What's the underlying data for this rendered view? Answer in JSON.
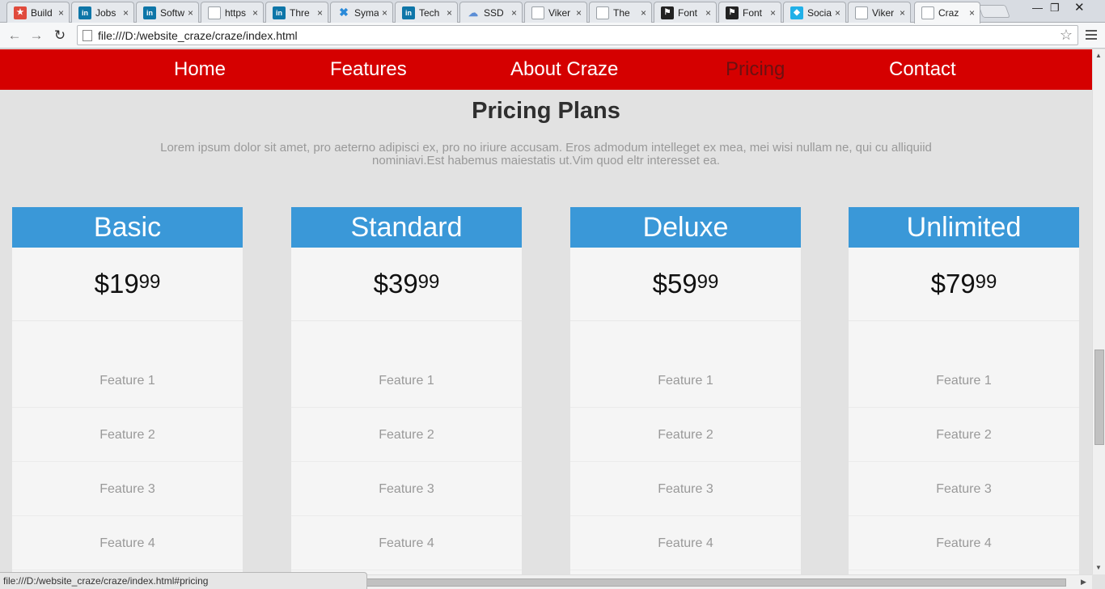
{
  "browser": {
    "tabs": [
      {
        "title": "Build",
        "favicon": "build-icon",
        "active": false
      },
      {
        "title": "Jobs",
        "favicon": "linkedin-icon",
        "active": false
      },
      {
        "title": "Softw",
        "favicon": "linkedin-icon",
        "active": false
      },
      {
        "title": "https",
        "favicon": "page-icon",
        "active": false
      },
      {
        "title": "Thre",
        "favicon": "linkedin-icon",
        "active": false
      },
      {
        "title": "Syma",
        "favicon": "x-icon",
        "active": false
      },
      {
        "title": "Tech",
        "favicon": "linkedin-icon",
        "active": false
      },
      {
        "title": "SSD",
        "favicon": "cloud-icon",
        "active": false
      },
      {
        "title": "Viker",
        "favicon": "page-icon",
        "active": false
      },
      {
        "title": "The",
        "favicon": "page-icon",
        "active": false
      },
      {
        "title": "Font",
        "favicon": "flag-icon",
        "active": false
      },
      {
        "title": "Font",
        "favicon": "flag-icon",
        "active": false
      },
      {
        "title": "Socia",
        "favicon": "social-icon",
        "active": false
      },
      {
        "title": "Viker",
        "favicon": "page-icon",
        "active": false
      },
      {
        "title": "Craz",
        "favicon": "page-icon",
        "active": true
      }
    ],
    "tab_close_glyph": "×",
    "url": "file:///D:/website_craze/craze/index.html",
    "status_url": "file:///D:/website_craze/craze/index.html#pricing"
  },
  "nav": {
    "items": [
      {
        "label": "Home",
        "current": false
      },
      {
        "label": "Features",
        "current": false
      },
      {
        "label": "About Craze",
        "current": false
      },
      {
        "label": "Pricing",
        "current": true
      },
      {
        "label": "Contact",
        "current": false
      }
    ]
  },
  "pricing": {
    "title": "Pricing Plans",
    "description": "Lorem ipsum dolor sit amet, pro aeterno adipisci ex, pro no iriure accusam. Eros admodum intelleget ex mea, mei wisi nullam ne, qui cu alliquiid nominiavi.Est habemus maiestatis ut.Vim quod eltr interesset ea.",
    "plans": [
      {
        "name": "Basic",
        "price_main": "$19",
        "price_cents": "99",
        "features": [
          "Feature 1",
          "Feature 2",
          "Feature 3",
          "Feature 4"
        ]
      },
      {
        "name": "Standard",
        "price_main": "$39",
        "price_cents": "99",
        "features": [
          "Feature 1",
          "Feature 2",
          "Feature 3",
          "Feature 4"
        ]
      },
      {
        "name": "Deluxe",
        "price_main": "$59",
        "price_cents": "99",
        "features": [
          "Feature 1",
          "Feature 2",
          "Feature 3",
          "Feature 4"
        ]
      },
      {
        "name": "Unlimited",
        "price_main": "$79",
        "price_cents": "99",
        "features": [
          "Feature 1",
          "Feature 2",
          "Feature 3",
          "Feature 4"
        ]
      }
    ]
  },
  "colors": {
    "nav_background": "#d50000",
    "nav_current": "#6b1111",
    "plan_header": "#3a98d8",
    "page_background": "#e2e2e2"
  }
}
